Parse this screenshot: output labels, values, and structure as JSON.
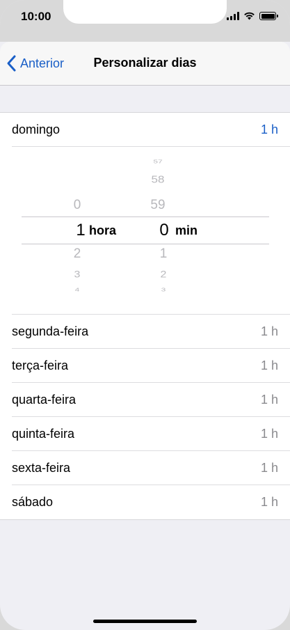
{
  "status": {
    "time": "10:00"
  },
  "nav": {
    "back_label": "Anterior",
    "title": "Personalizar dias"
  },
  "days": [
    {
      "name": "domingo",
      "value": "1 h"
    },
    {
      "name": "segunda-feira",
      "value": "1 h"
    },
    {
      "name": "terça-feira",
      "value": "1 h"
    },
    {
      "name": "quarta-feira",
      "value": "1 h"
    },
    {
      "name": "quinta-feira",
      "value": "1 h"
    },
    {
      "name": "sexta-feira",
      "value": "1 h"
    },
    {
      "name": "sábado",
      "value": "1 h"
    }
  ],
  "picker": {
    "hours": {
      "above": [
        "0"
      ],
      "selected": "1",
      "below": [
        "2",
        "3",
        "4"
      ],
      "unit": "hora"
    },
    "minutes": {
      "above": [
        "57",
        "58",
        "59"
      ],
      "selected": "0",
      "below": [
        "1",
        "2",
        "3"
      ],
      "unit": "min"
    }
  },
  "colors": {
    "accent": "#1a5fc7",
    "secondary_text": "#8a8a8e",
    "background": "#efeff4"
  }
}
